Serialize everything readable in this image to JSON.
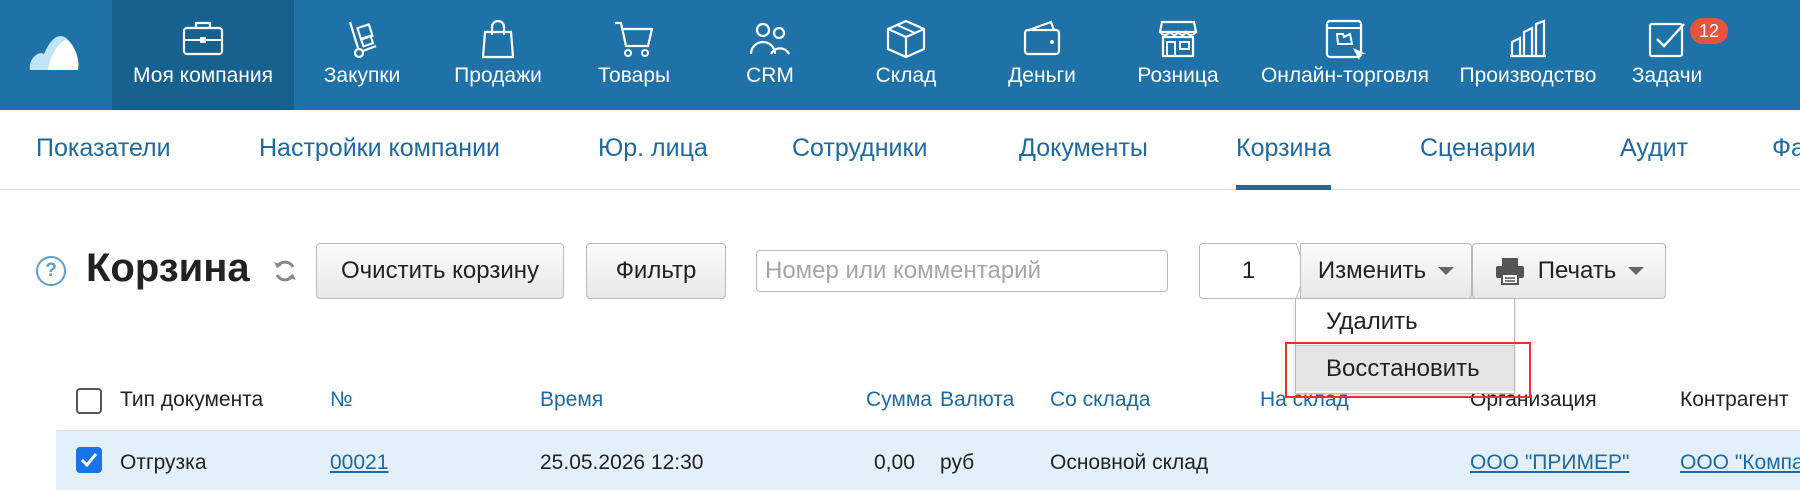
{
  "topnav": {
    "items": [
      {
        "label": "Моя компания",
        "icon": "briefcase-icon"
      },
      {
        "label": "Закупки",
        "icon": "hand-truck-icon"
      },
      {
        "label": "Продажи",
        "icon": "shopping-bag-icon"
      },
      {
        "label": "Товары",
        "icon": "cart-icon"
      },
      {
        "label": "CRM",
        "icon": "people-icon"
      },
      {
        "label": "Склад",
        "icon": "box-icon"
      },
      {
        "label": "Деньги",
        "icon": "wallet-icon"
      },
      {
        "label": "Розница",
        "icon": "store-icon"
      },
      {
        "label": "Онлайн-торговля",
        "icon": "online-store-icon"
      },
      {
        "label": "Производство",
        "icon": "factory-icon"
      },
      {
        "label": "Задачи",
        "icon": "tasks-check-icon"
      }
    ],
    "tasks_badge": "12"
  },
  "subnav": {
    "tabs": [
      "Показатели",
      "Настройки компании",
      "Юр. лица",
      "Сотрудники",
      "Документы",
      "Корзина",
      "Сценарии",
      "Аудит",
      "Фа"
    ]
  },
  "toolbar": {
    "help": "?",
    "title": "Корзина",
    "clear_label": "Очистить корзину",
    "filter_label": "Фильтр",
    "search_placeholder": "Номер или комментарий",
    "selected_count": "1",
    "change_label": "Изменить",
    "print_label": "Печать"
  },
  "dropdown": {
    "options": [
      "Удалить",
      "Восстановить"
    ]
  },
  "table": {
    "headers": [
      "Тип документа",
      "№",
      "Время",
      "Сумма",
      "Валюта",
      "Со склада",
      "На склад",
      "Организация",
      "Контрагент"
    ],
    "rows": [
      {
        "checked": true,
        "type": "Отгрузка",
        "number": "00021",
        "time": "25.05.2026 12:30",
        "sum": "0,00",
        "currency": "руб",
        "from_store": "Основной склад",
        "to_store": "",
        "organization": "ООО \"ПРИМЕР\"",
        "counterparty": "ООО \"Компа"
      }
    ]
  },
  "colors": {
    "topbar": "#1e72a8",
    "active_topnav": "#17618f",
    "link": "#1e6aa0",
    "row_selected": "#e3f0fa",
    "highlight": "#e8332a"
  }
}
